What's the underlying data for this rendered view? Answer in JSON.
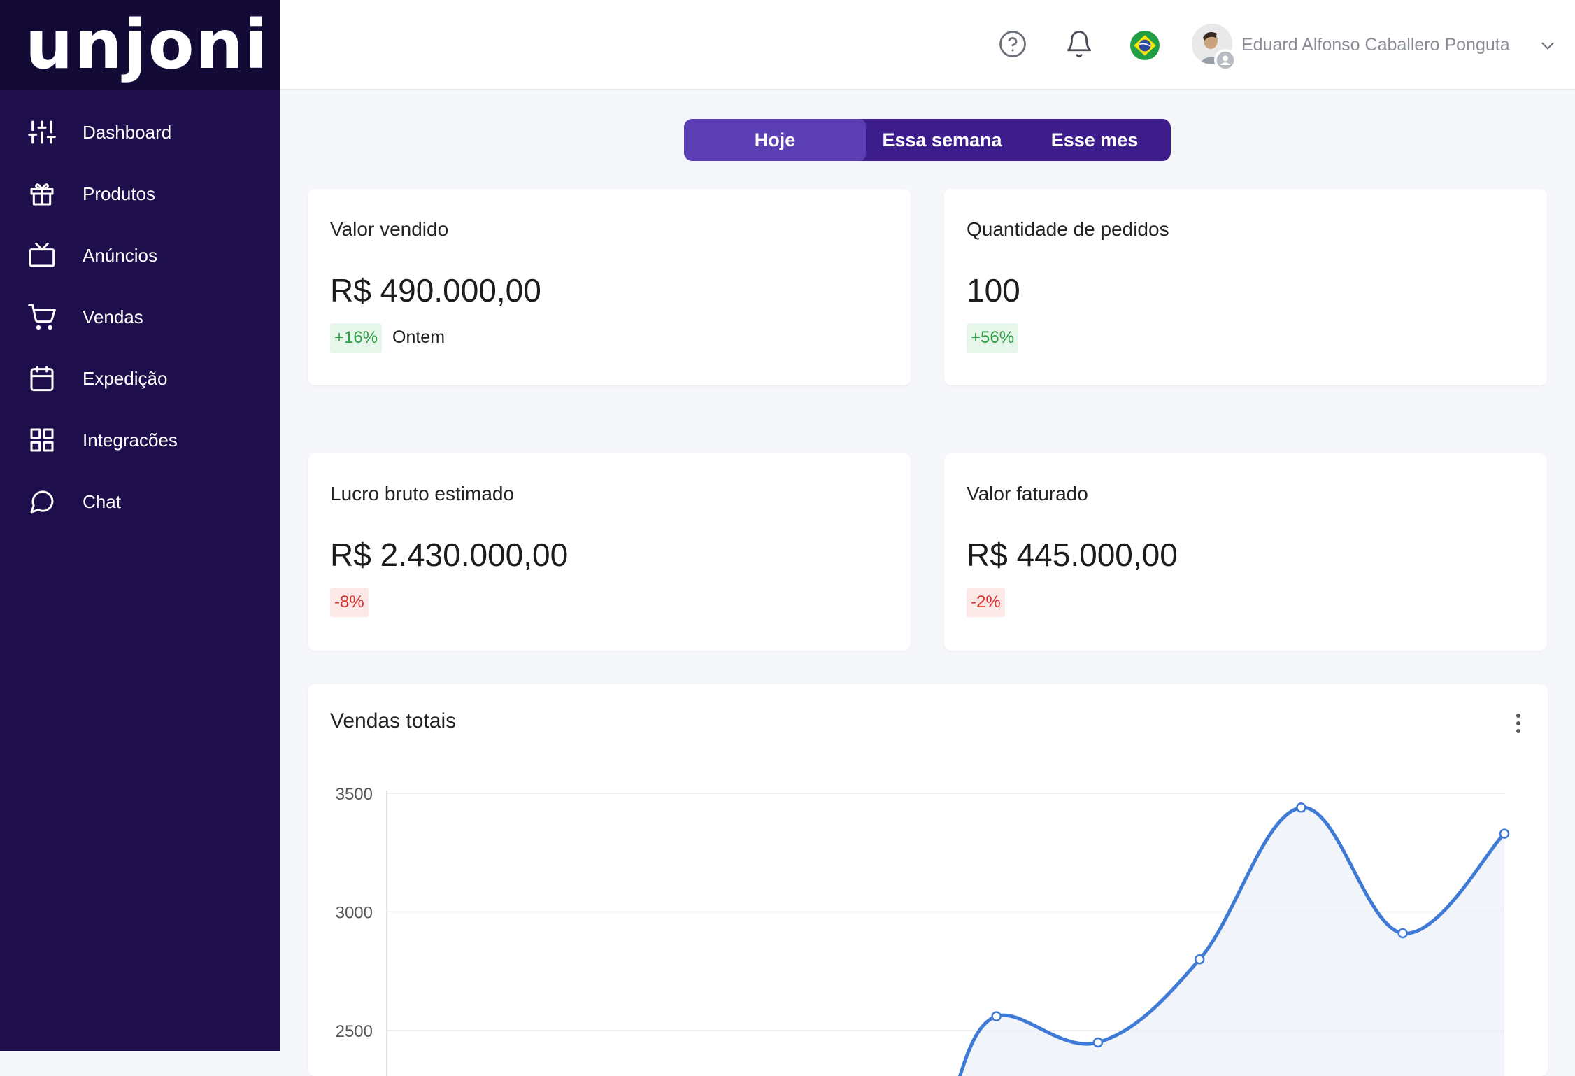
{
  "app": {
    "logo_text": "unjoni"
  },
  "sidebar": {
    "items": [
      {
        "label": "Dashboard",
        "icon": "sliders-icon"
      },
      {
        "label": "Produtos",
        "icon": "gift-icon"
      },
      {
        "label": "Anúncios",
        "icon": "tv-icon"
      },
      {
        "label": "Vendas",
        "icon": "cart-icon"
      },
      {
        "label": "Expedição",
        "icon": "calendar-icon"
      },
      {
        "label": "Integracões",
        "icon": "grid-icon"
      },
      {
        "label": "Chat",
        "icon": "chat-icon"
      }
    ]
  },
  "header": {
    "help_icon": "help-icon",
    "notification_icon": "bell-icon",
    "language_flag": "brazil-flag-icon",
    "user_name": "Eduard Alfonso Caballero Ponguta"
  },
  "period_toggle": {
    "options": [
      "Hoje",
      "Essa semana",
      "Esse mes"
    ],
    "selected": "Hoje"
  },
  "cards": {
    "valor_vendido": {
      "title": "Valor vendido",
      "value": "R$ 490.000,00",
      "change": "+16%",
      "change_note": "Ontem"
    },
    "quantidade_pedidos": {
      "title": "Quantidade de pedidos",
      "value": "100",
      "change": "+56%"
    },
    "lucro_bruto": {
      "title": "Lucro bruto estimado",
      "value": "R$ 2.430.000,00",
      "change": "-8%"
    },
    "valor_faturado": {
      "title": "Valor faturado",
      "value": "R$ 445.000,00",
      "change": "-2%"
    }
  },
  "colors": {
    "sidebar_bg": "#1e0f4c",
    "accent": "#5b3eb3",
    "positive": "#2f9e44",
    "negative": "#d9302c",
    "line": "#3f7bd6"
  },
  "chart_data": {
    "type": "area",
    "title": "Vendas totais",
    "ytick_labels": [
      "3500",
      "3000",
      "2500"
    ],
    "ylim": [
      2500,
      3500
    ],
    "x_index": [
      0,
      1,
      2,
      3,
      4,
      5,
      6,
      7,
      8,
      9,
      10,
      11
    ],
    "values": [
      null,
      null,
      null,
      null,
      null,
      null,
      2560,
      2450,
      2800,
      3440,
      2910,
      3330
    ],
    "grid": true
  }
}
